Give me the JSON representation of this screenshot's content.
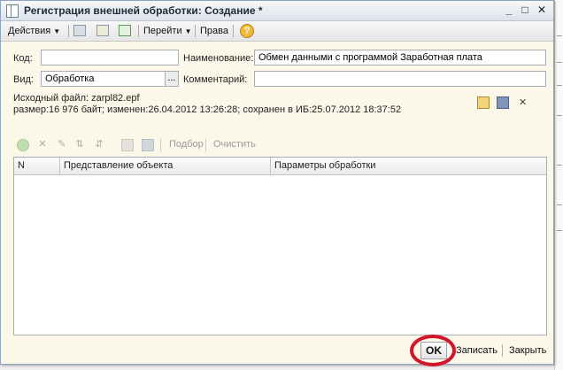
{
  "window": {
    "title": "Регистрация внешней обработки: Создание *",
    "minimize": "_",
    "maximize": "□",
    "close": "✕"
  },
  "toolbar": {
    "actions_label": "Действия",
    "goto_label": "Перейти",
    "rights_label": "Права",
    "help_symbol": "?"
  },
  "form": {
    "code_label": "Код:",
    "code_value": "",
    "name_label": "Наименование:",
    "name_value": "Обмен данными с программой Заработная плата",
    "kind_label": "Вид:",
    "kind_value": "Обработка",
    "kind_select": "...",
    "comment_label": "Комментарий:",
    "comment_value": "",
    "source_line": "Исходный файл: zarpl82.epf",
    "size_line": "размер:16 976 байт; изменен:26.04.2012 13:26:28; сохранен в ИБ:25.07.2012 18:37:52",
    "close_x": "✕"
  },
  "grid_toolbar": {
    "select_label": "Подбор",
    "clear_label": "Очистить"
  },
  "table": {
    "columns": [
      "N",
      "Представление объекта",
      "Параметры обработки"
    ]
  },
  "footer": {
    "ok_label": "OK",
    "save_label": "Записать",
    "close_label": "Закрыть"
  },
  "colors": {
    "highlight_circle": "#d4142a",
    "window_background": "#fbf8e9"
  }
}
